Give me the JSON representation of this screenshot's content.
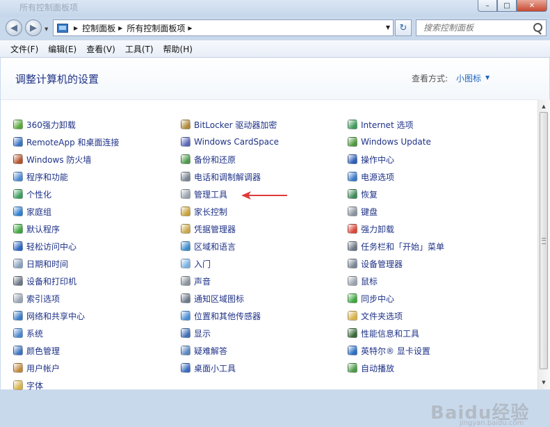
{
  "window": {
    "title": "所有控制面板项",
    "buttons": {
      "minimize": "–",
      "maximize": "□",
      "close": "✕"
    }
  },
  "address_bar": {
    "crumbs": [
      "控制面板",
      "所有控制面板项"
    ],
    "search_placeholder": "搜索控制面板"
  },
  "menu": [
    "文件(F)",
    "编辑(E)",
    "查看(V)",
    "工具(T)",
    "帮助(H)"
  ],
  "header": {
    "title": "调整计算机的设置",
    "view_label": "查看方式:",
    "view_value": "小图标"
  },
  "columns": [
    [
      {
        "label": "360强力卸载",
        "icon": "uninstall-icon",
        "color": "#5aa83a"
      },
      {
        "label": "RemoteApp 和桌面连接",
        "icon": "remote-desktop-icon",
        "color": "#3b73c2"
      },
      {
        "label": "Windows 防火墙",
        "icon": "firewall-icon",
        "color": "#b5522b"
      },
      {
        "label": "程序和功能",
        "icon": "programs-icon",
        "color": "#4d8ad1"
      },
      {
        "label": "个性化",
        "icon": "personalization-icon",
        "color": "#3a9d5d"
      },
      {
        "label": "家庭组",
        "icon": "homegroup-icon",
        "color": "#2f7fd0"
      },
      {
        "label": "默认程序",
        "icon": "default-programs-icon",
        "color": "#3fa640"
      },
      {
        "label": "轻松访问中心",
        "icon": "ease-of-access-icon",
        "color": "#2b66c4"
      },
      {
        "label": "日期和时间",
        "icon": "clock-icon",
        "color": "#8aa0c0"
      },
      {
        "label": "设备和打印机",
        "icon": "printer-icon",
        "color": "#6b7685"
      },
      {
        "label": "索引选项",
        "icon": "index-icon",
        "color": "#9aa6b5"
      },
      {
        "label": "网络和共享中心",
        "icon": "network-icon",
        "color": "#3c7dc8"
      },
      {
        "label": "系统",
        "icon": "system-icon",
        "color": "#4c87cf"
      },
      {
        "label": "颜色管理",
        "icon": "color-management-icon",
        "color": "#3f74c0"
      },
      {
        "label": "用户帐户",
        "icon": "user-accounts-icon",
        "color": "#c28a3d"
      },
      {
        "label": "字体",
        "icon": "fonts-icon",
        "color": "#d8b24a"
      }
    ],
    [
      {
        "label": "BitLocker 驱动器加密",
        "icon": "bitlocker-icon",
        "color": "#b08a3a"
      },
      {
        "label": "Windows CardSpace",
        "icon": "cardspace-icon",
        "color": "#5a67b8"
      },
      {
        "label": "备份和还原",
        "icon": "backup-icon",
        "color": "#4d9a4a"
      },
      {
        "label": "电话和调制解调器",
        "icon": "phone-modem-icon",
        "color": "#7a8594"
      },
      {
        "label": "管理工具",
        "icon": "admin-tools-icon",
        "color": "#9aa3ae"
      },
      {
        "label": "家长控制",
        "icon": "parental-controls-icon",
        "color": "#c9a23a"
      },
      {
        "label": "凭据管理器",
        "icon": "credential-manager-icon",
        "color": "#c9a84a"
      },
      {
        "label": "区域和语言",
        "icon": "region-language-icon",
        "color": "#3a8ccb"
      },
      {
        "label": "入门",
        "icon": "getting-started-icon",
        "color": "#7ab0e0"
      },
      {
        "label": "声音",
        "icon": "speaker-icon",
        "color": "#8a939e"
      },
      {
        "label": "通知区域图标",
        "icon": "notification-area-icon",
        "color": "#6d7a8a"
      },
      {
        "label": "位置和其他传感器",
        "icon": "sensor-icon",
        "color": "#4a8fd6"
      },
      {
        "label": "显示",
        "icon": "display-icon",
        "color": "#3f6fb5"
      },
      {
        "label": "疑难解答",
        "icon": "troubleshoot-icon",
        "color": "#5a86c0"
      },
      {
        "label": "桌面小工具",
        "icon": "gadgets-icon",
        "color": "#3a6cc0"
      }
    ],
    [
      {
        "label": "Internet 选项",
        "icon": "internet-options-icon",
        "color": "#3f9a5a"
      },
      {
        "label": "Windows Update",
        "icon": "windows-update-icon",
        "color": "#4e9a3f"
      },
      {
        "label": "操作中心",
        "icon": "action-center-flag-icon",
        "color": "#2f5fb5"
      },
      {
        "label": "电源选项",
        "icon": "power-options-icon",
        "color": "#3a7ac8"
      },
      {
        "label": "恢复",
        "icon": "recovery-icon",
        "color": "#3f8a5a"
      },
      {
        "label": "键盘",
        "icon": "keyboard-icon",
        "color": "#8a939e"
      },
      {
        "label": "强力卸载",
        "icon": "force-uninstall-icon",
        "color": "#d9483a"
      },
      {
        "label": "任务栏和「开始」菜单",
        "icon": "taskbar-icon",
        "color": "#6b7685"
      },
      {
        "label": "设备管理器",
        "icon": "device-manager-icon",
        "color": "#7a8594"
      },
      {
        "label": "鼠标",
        "icon": "mouse-icon",
        "color": "#9aa3ae"
      },
      {
        "label": "同步中心",
        "icon": "sync-center-icon",
        "color": "#3fa640"
      },
      {
        "label": "文件夹选项",
        "icon": "folder-options-icon",
        "color": "#d8b24a"
      },
      {
        "label": "性能信息和工具",
        "icon": "performance-icon",
        "color": "#3a6a3a"
      },
      {
        "label": "英特尔® 显卡设置",
        "icon": "intel-graphics-icon",
        "color": "#2f6fc0"
      },
      {
        "label": "自动播放",
        "icon": "autoplay-icon",
        "color": "#4d9a4a"
      }
    ]
  ],
  "watermark": {
    "text": "Baidu经验",
    "sub": "jingyan.baidu.com"
  },
  "accent": {
    "annotation_arrow": "#e03a3a",
    "link": "#1e3287"
  }
}
